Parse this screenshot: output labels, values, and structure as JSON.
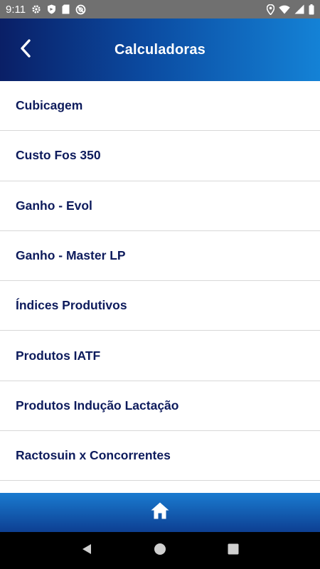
{
  "status_bar": {
    "time": "9:11",
    "left_icons": [
      "gear-icon",
      "shield-icon",
      "sd-card-icon",
      "no-sync-icon"
    ],
    "right_icons": [
      "location-icon",
      "wifi-icon",
      "signal-icon",
      "battery-icon"
    ]
  },
  "app_bar": {
    "title": "Calculadoras",
    "back_icon": "chevron-left-icon"
  },
  "calculators": [
    "Cubicagem",
    "Custo Fos 350",
    "Ganho - Evol",
    "Ganho - Master LP",
    "Índices Produtivos",
    "Produtos IATF",
    "Produtos Indução Lactação",
    "Ractosuin x Concorrentes"
  ],
  "bottom_bar": {
    "home_icon": "home-icon"
  },
  "nav_bar": {
    "icons": [
      "back-triangle-icon",
      "home-circle-icon",
      "recents-square-icon"
    ]
  },
  "colors": {
    "text": "#0d1b5c",
    "app_bar_start": "#0a1f66",
    "app_bar_end": "#1482d6",
    "status_bar": "#707070"
  }
}
